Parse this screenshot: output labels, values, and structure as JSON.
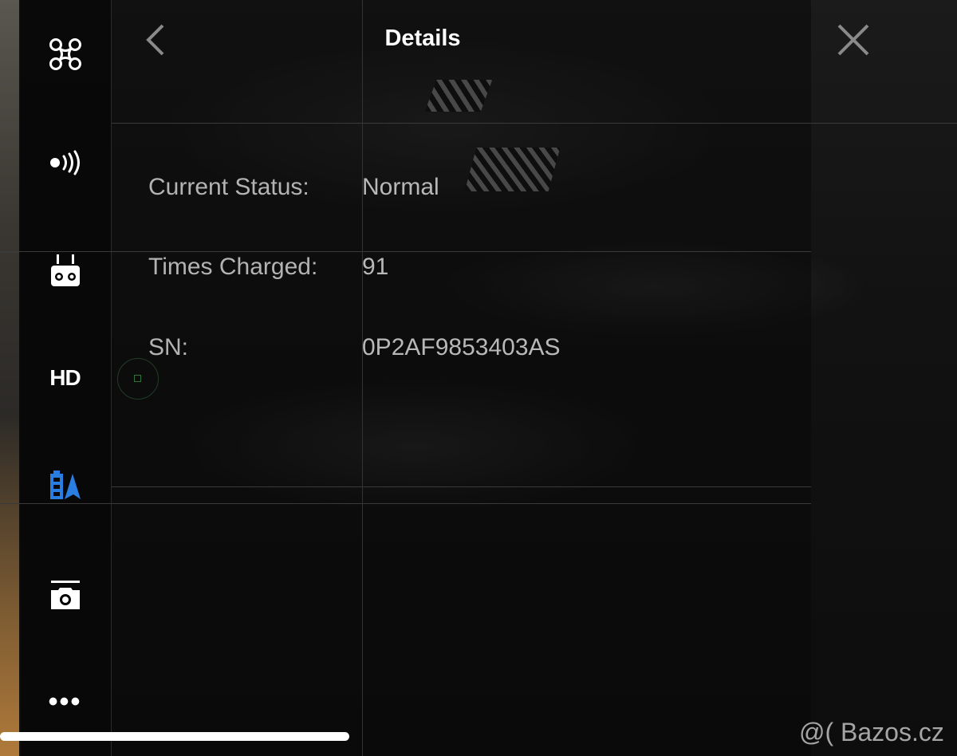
{
  "header": {
    "title": "Details",
    "back_icon": "chevron-left-icon",
    "close_icon": "close-icon"
  },
  "sidebar": {
    "items": [
      {
        "id": "aircraft",
        "icon": "drone-icon",
        "active": false
      },
      {
        "id": "signal",
        "icon": "signal-broadcast-icon",
        "active": false
      },
      {
        "id": "remote",
        "icon": "remote-controller-icon",
        "active": false
      },
      {
        "id": "hd",
        "label": "HD",
        "active": false
      },
      {
        "id": "battery",
        "icon": "battery-icon",
        "active": true
      },
      {
        "id": "camera",
        "icon": "camera-icon",
        "active": false
      },
      {
        "id": "more",
        "label": "•••",
        "active": false
      }
    ],
    "active_color": "#2a7de1"
  },
  "details": {
    "rows": [
      {
        "label": "Current Status:",
        "value": "Normal"
      },
      {
        "label": "Times Charged:",
        "value": "91"
      },
      {
        "label": "SN:",
        "value": "0P2AF9853403AS"
      }
    ]
  },
  "watermark": "@( Bazos.cz"
}
